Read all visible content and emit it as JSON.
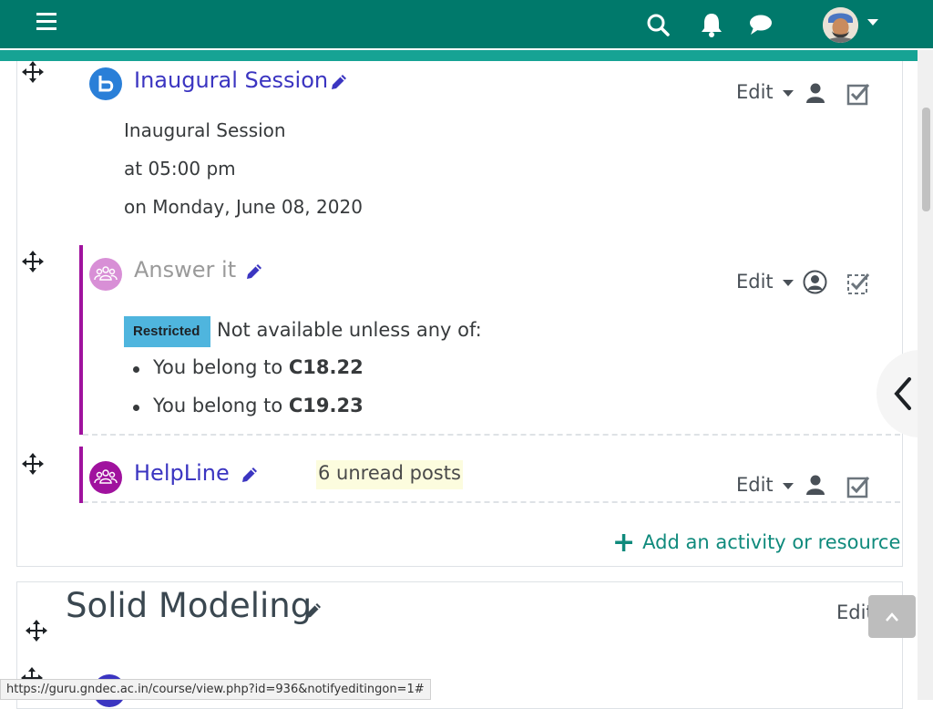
{
  "navbar": {
    "menu_icon": "hamburger-icon",
    "search_icon": "search-icon",
    "notifications_icon": "bell-icon",
    "messages_icon": "chat-icon",
    "avatar_icon": "user-avatar",
    "colors": {
      "primary": "#00796b",
      "stripe": "#16a394"
    }
  },
  "activities": [
    {
      "title": "Inaugural Session",
      "icon": "bigbluebutton-icon",
      "edit_label": "Edit",
      "details": [
        "Inaugural Session",
        "at 05:00 pm",
        "on Monday, June 08, 2020"
      ],
      "title_color": "#3b35c1"
    },
    {
      "title": "Answer it",
      "icon": "forum-group-icon",
      "edit_label": "Edit",
      "restricted_badge": "Restricted",
      "restriction_text": "Not available unless any of:",
      "conditions": [
        {
          "prefix": "You belong to ",
          "group": "C18.22"
        },
        {
          "prefix": "You belong to ",
          "group": "C19.23"
        }
      ],
      "title_color": "#9a9a9a"
    },
    {
      "title": "HelpLine",
      "icon": "forum-group-icon",
      "edit_label": "Edit",
      "unread": "6 unread posts",
      "title_color": "#3b35c1"
    }
  ],
  "add_activity_label": "Add an activity or resource",
  "next_section": {
    "title": "Solid Modeling",
    "edit_label": "Edit"
  },
  "status_bar": {
    "url": "https://guru.gndec.ac.in/course/view.php?id=936&notifyeditingon=1#"
  }
}
